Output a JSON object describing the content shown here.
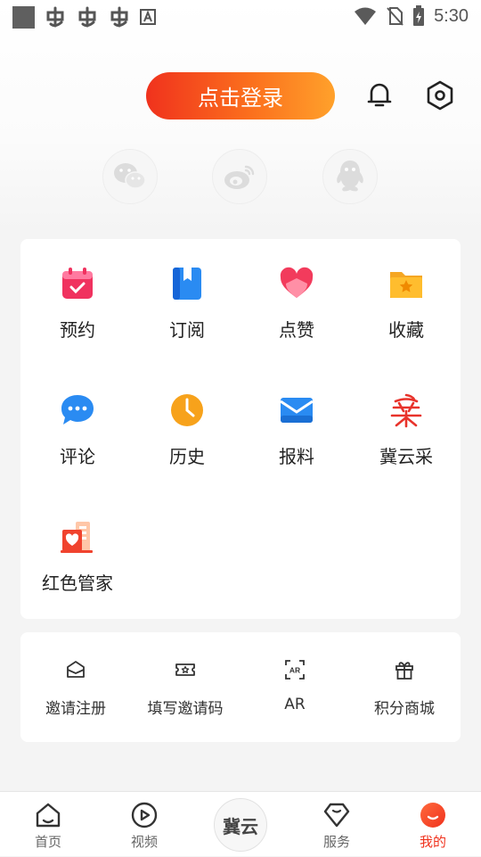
{
  "status_bar": {
    "time": "5:30"
  },
  "header": {
    "login_label": "点击登录"
  },
  "social_logins": [
    {
      "name": "wechat",
      "icon": "wechat-icon"
    },
    {
      "name": "weibo",
      "icon": "weibo-icon"
    },
    {
      "name": "qq",
      "icon": "qq-icon"
    }
  ],
  "features": [
    {
      "label": "预约",
      "icon": "calendar-icon"
    },
    {
      "label": "订阅",
      "icon": "bookmark-book-icon"
    },
    {
      "label": "点赞",
      "icon": "heart-icon"
    },
    {
      "label": "收藏",
      "icon": "star-folder-icon"
    },
    {
      "label": "评论",
      "icon": "chat-bubble-icon"
    },
    {
      "label": "历史",
      "icon": "clock-icon"
    },
    {
      "label": "报料",
      "icon": "mail-icon"
    },
    {
      "label": "冀云采",
      "icon": "jiyuncai-icon"
    },
    {
      "label": "红色管家",
      "icon": "red-steward-icon"
    }
  ],
  "extras": [
    {
      "label": "邀请注册",
      "icon": "invite-envelope-icon"
    },
    {
      "label": "填写邀请码",
      "icon": "ticket-icon"
    },
    {
      "label": "AR",
      "icon": "ar-scan-icon"
    },
    {
      "label": "积分商城",
      "icon": "gift-icon"
    }
  ],
  "bottom_nav": {
    "items": [
      {
        "label": "首页",
        "icon": "home-icon"
      },
      {
        "label": "视频",
        "icon": "video-play-icon"
      },
      {
        "label": "服务",
        "icon": "service-icon"
      },
      {
        "label": "我的",
        "icon": "profile-icon",
        "active": true
      }
    ],
    "center_logo": "冀云"
  },
  "colors": {
    "accent": "#f0321d",
    "accent_end": "#ffa12b"
  }
}
